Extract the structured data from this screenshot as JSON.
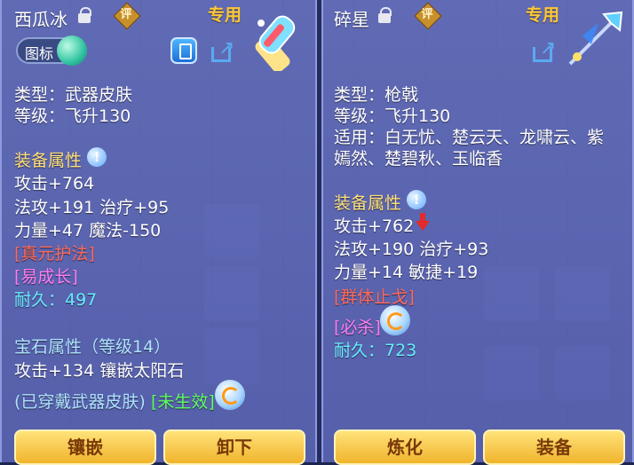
{
  "left_panel": {
    "item_name": "西瓜冰",
    "review_label": "评",
    "exclusive_label": "专用",
    "icon_toggle_label": "图标",
    "type_line": "类型：武器皮肤",
    "level_line": "等级：飞升130",
    "equip_attr_title": "装备属性",
    "attr_lines": [
      "攻击+764",
      "法攻+191 治疗+95",
      "力量+47 魔法-150"
    ],
    "skill_1": "[真元护法]",
    "skill_2": "[易成长]",
    "durability": "耐久：497",
    "gem_attr_title": "宝石属性（等级14）",
    "gem_attr_line": "攻击+134 镶嵌太阳石",
    "status_worn": "(已穿戴武器皮肤)",
    "status_inactive": "[未生效]",
    "buttons": {
      "inlay": "镶嵌",
      "unload": "卸下"
    }
  },
  "right_panel": {
    "item_name": "碎星",
    "review_label": "评",
    "exclusive_label": "专用",
    "type_line": "类型：枪戟",
    "level_line": "等级：飞升130",
    "suit_line_1": "适用：白无忧、楚云天、龙啸云、紫",
    "suit_line_2": "嫣然、楚碧秋、玉临香",
    "equip_attr_title": "装备属性",
    "attr_lines": [
      "攻击+762",
      "法攻+190 治疗+93",
      "力量+14 敏捷+19"
    ],
    "skill_1": "[群体止戈]",
    "skill_2": "[必杀]",
    "durability": "耐久：723",
    "buttons": {
      "refine": "炼化",
      "equip": "装备"
    }
  },
  "colors": {
    "panel": "#6e78c8",
    "gold_title": "#ffc833",
    "skill_red": "#ff6a5a",
    "skill_pink": "#ff7cf2",
    "durability_cyan": "#67ecff",
    "inactive_green": "#5fff5f",
    "button_gold": "#f0b42c"
  }
}
